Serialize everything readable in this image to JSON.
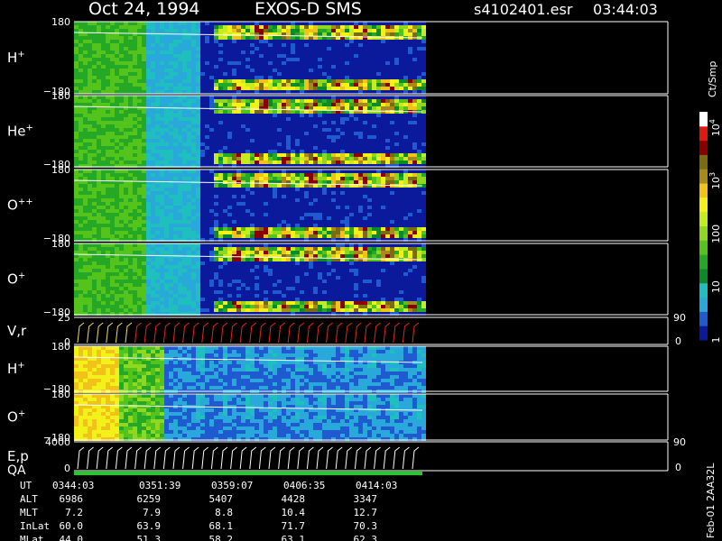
{
  "header": {
    "date": "Oct 24, 1994",
    "instrument": "EXOS-D SMS",
    "file": "s4102401.esr",
    "time": "03:44:03"
  },
  "side_label": "Feb-01 2AA32L",
  "colorbar": {
    "unit": "Ct/Smp",
    "ticks": [
      {
        "label": "1",
        "value": 1
      },
      {
        "label": "10",
        "value": 10
      },
      {
        "label": "100",
        "value": 100
      },
      {
        "label": "10",
        "exp": "3",
        "value": 1000
      },
      {
        "label": "10",
        "exp": "4",
        "value": 10000
      }
    ],
    "colors": [
      "#0a1a9a",
      "#1f5ad0",
      "#29a9d9",
      "#1fbfbf",
      "#0a8a28",
      "#25a825",
      "#54c41c",
      "#8fd81f",
      "#c4ec1f",
      "#f2f21a",
      "#f0c21a",
      "#a88a1a",
      "#7a6a10",
      "#8a0000",
      "#e01a10",
      "#ffffff"
    ]
  },
  "chart_data": [
    {
      "type": "heatmap",
      "panel": "H+ pitch angle",
      "label": "H",
      "sup": "+",
      "ylim": [
        -180,
        180
      ],
      "ticks": [
        "180",
        "−180"
      ],
      "color_scale": "log counts per sample"
    },
    {
      "type": "heatmap",
      "panel": "He+ pitch angle",
      "label": "He",
      "sup": "+",
      "ylim": [
        -180,
        180
      ],
      "ticks": [
        "180",
        "−180"
      ],
      "color_scale": "log counts per sample"
    },
    {
      "type": "heatmap",
      "panel": "O++ pitch angle",
      "label": "O",
      "sup": "++",
      "ylim": [
        -180,
        180
      ],
      "ticks": [
        "180",
        "−180"
      ],
      "color_scale": "log counts per sample"
    },
    {
      "type": "heatmap",
      "panel": "O+ pitch angle",
      "label": "O",
      "sup": "+",
      "ylim": [
        -180,
        180
      ],
      "ticks": [
        "180",
        "−180"
      ],
      "color_scale": "log counts per sample"
    },
    {
      "type": "line",
      "panel": "V,r",
      "label": "V,r",
      "ylim": [
        0,
        25
      ],
      "ticks": [
        "25",
        "0"
      ],
      "right_ticks": [
        "90",
        "0"
      ]
    },
    {
      "type": "heatmap",
      "panel": "H+ energy",
      "label": "H",
      "sup": "+",
      "ylim": [
        -180,
        180
      ],
      "ticks": [
        "180",
        "−180"
      ]
    },
    {
      "type": "heatmap",
      "panel": "O+ energy",
      "label": "O",
      "sup": "+",
      "ylim": [
        -180,
        180
      ],
      "ticks": [
        "180",
        "−180"
      ]
    },
    {
      "type": "line",
      "panel": "E,p QA",
      "label": "E,p",
      "label2": "QA",
      "ylim": [
        0,
        4000
      ],
      "ticks": [
        "4000",
        "0"
      ],
      "right_ticks": [
        "90",
        "0"
      ]
    }
  ],
  "ephemeris": {
    "columns": [
      "0344:03",
      "0351:39",
      "0359:07",
      "0406:35",
      "0414:03"
    ],
    "rows": [
      {
        "name": "UT",
        "values": [
          "0344:03",
          "0351:39",
          "0359:07",
          "0406:35",
          "0414:03"
        ]
      },
      {
        "name": "ALT",
        "values": [
          "6986",
          "6259",
          "5407",
          "4428",
          "3347"
        ]
      },
      {
        "name": "MLT",
        "values": [
          "7.2",
          "7.9",
          "8.8",
          "10.4",
          "12.7"
        ]
      },
      {
        "name": "InLat",
        "values": [
          "60.0",
          "63.9",
          "68.1",
          "71.7",
          "70.3"
        ]
      },
      {
        "name": "MLat",
        "values": [
          "44.0",
          "51.3",
          "58.2",
          "63.1",
          "62.3"
        ]
      }
    ]
  }
}
